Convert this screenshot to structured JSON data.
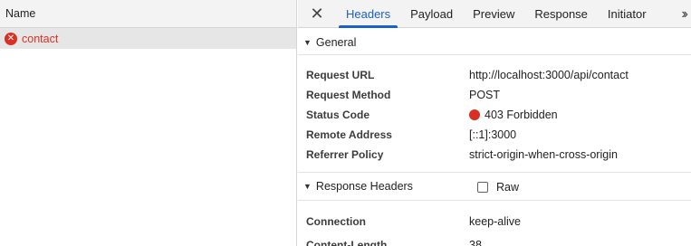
{
  "left": {
    "column_header": "Name",
    "request": {
      "name": "contact",
      "icon": "error-icon",
      "color": "#d93025"
    }
  },
  "tabs": {
    "close_icon": "close-icon",
    "items": [
      "Headers",
      "Payload",
      "Preview",
      "Response",
      "Initiator"
    ],
    "active": "Headers",
    "more_icon": "chevron-double-right-icon"
  },
  "general": {
    "title": "General",
    "rows": [
      {
        "key": "Request URL",
        "value": "http://localhost:3000/api/contact"
      },
      {
        "key": "Request Method",
        "value": "POST"
      },
      {
        "key": "Status Code",
        "value": "403 Forbidden"
      },
      {
        "key": "Remote Address",
        "value": "[::1]:3000"
      },
      {
        "key": "Referrer Policy",
        "value": "strict-origin-when-cross-origin"
      }
    ]
  },
  "response_headers": {
    "title": "Response Headers",
    "raw_label": "Raw",
    "raw_checked": false,
    "rows": [
      {
        "key": "Connection",
        "value": "keep-alive"
      },
      {
        "key": "Content-Length",
        "value": "38"
      }
    ]
  },
  "colors": {
    "accent": "#1a5fcc",
    "error": "#d93025"
  }
}
